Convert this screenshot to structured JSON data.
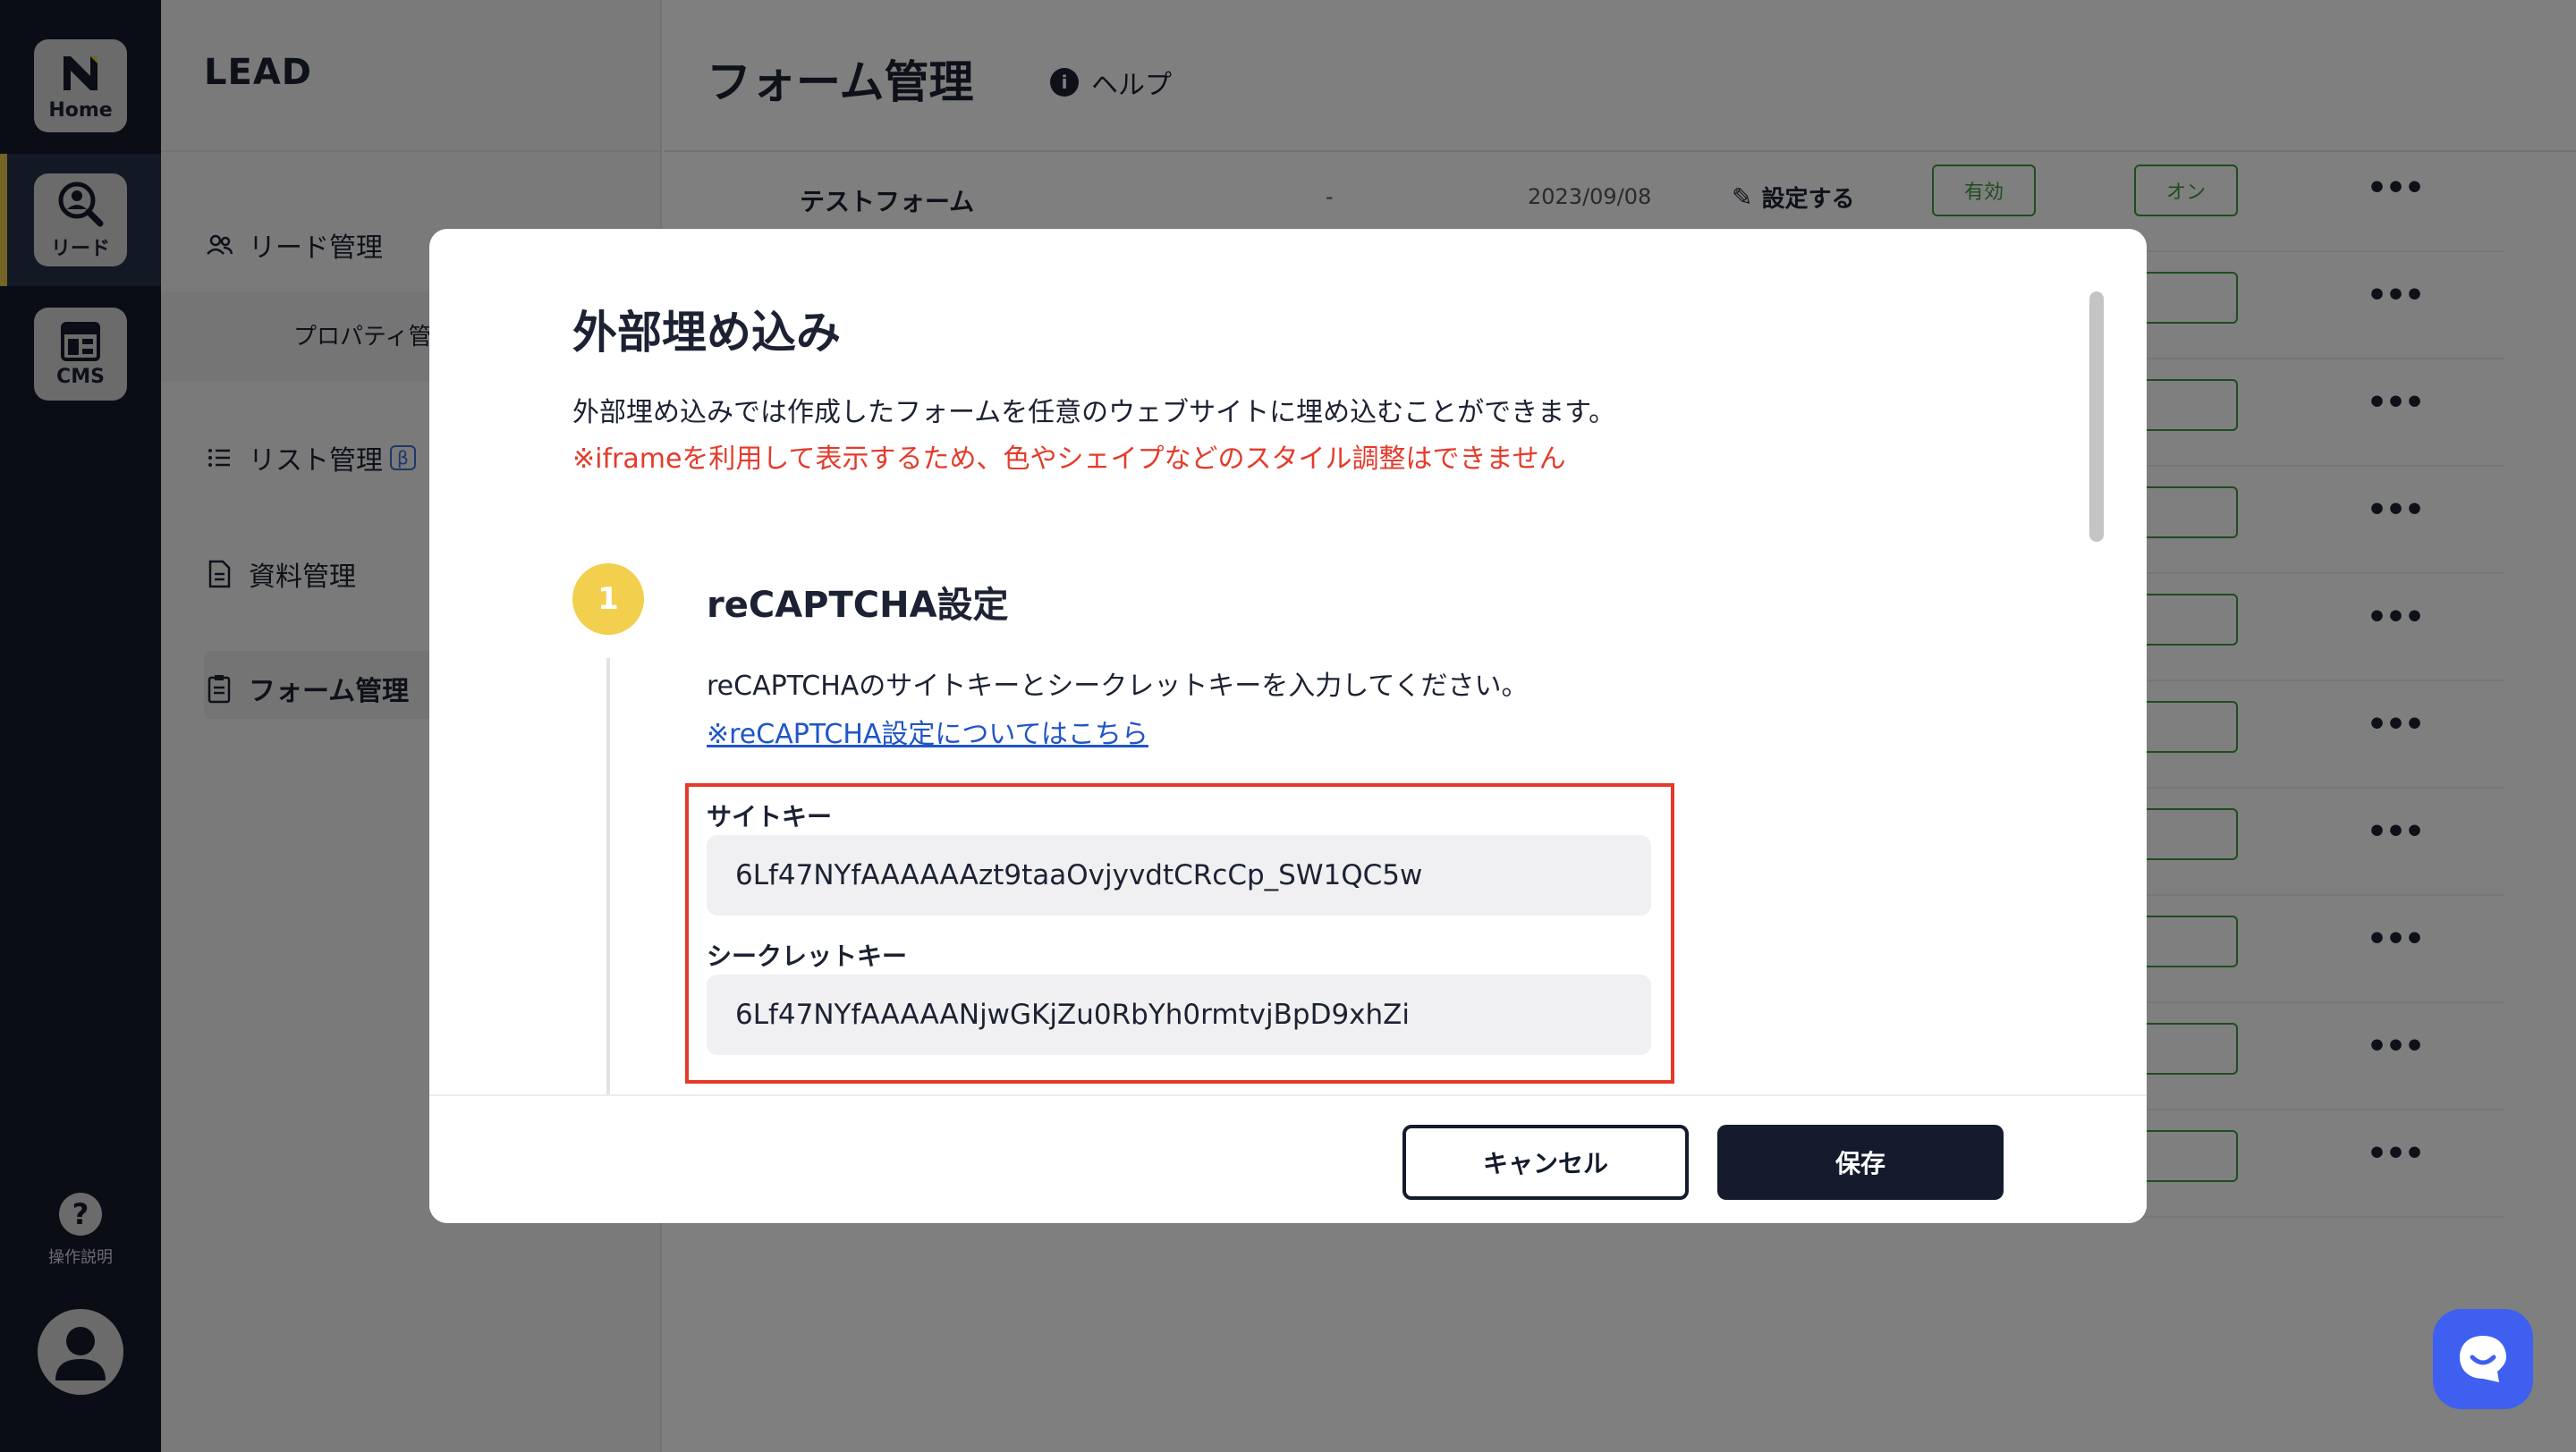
{
  "rail": {
    "home_label": "Home",
    "lead_label": "リード",
    "cms_label": "CMS",
    "help_label": "操作説明"
  },
  "sidebar": {
    "brand": "LEAD",
    "items": [
      {
        "label": "リード管理"
      },
      {
        "label": "プロパティ管"
      },
      {
        "label": "リスト管理",
        "badge": "β"
      },
      {
        "label": "資料管理"
      },
      {
        "label": "フォーム管理"
      }
    ]
  },
  "main": {
    "title": "フォーム管理",
    "help": "ヘルプ",
    "first_row": {
      "name": "テストフォーム",
      "dash": "-",
      "date": "2023/09/08",
      "setting": "設定する",
      "status": "有効",
      "toggle": "オン"
    },
    "more_glyph": "•••"
  },
  "modal": {
    "title": "外部埋め込み",
    "description": "外部埋め込みでは作成したフォームを任意のウェブサイトに埋め込むことができます。",
    "warning": "※iframeを利用して表示するため、色やシェイプなどのスタイル調整はできません",
    "step_number": "1",
    "step_title": "reCAPTCHA設定",
    "step_description": "reCAPTCHAのサイトキーとシークレットキーを入力してください。",
    "step_link": "※reCAPTCHA設定についてはこちら",
    "site_key_label": "サイトキー",
    "site_key_value": "6Lf47NYfAAAAAAzt9taaOvjyvdtCRcCp_SW1QC5w",
    "secret_key_label": "シークレットキー",
    "secret_key_value": "6Lf47NYfAAAAANjwGKjZu0RbYh0rmtvjBpD9xhZi",
    "cancel_label": "キャンセル",
    "save_label": "保存"
  },
  "colors": {
    "navy": "#141b2d",
    "accent_yellow": "#f3cf4e",
    "warning_red": "#e53a2a",
    "link_blue": "#1f55c8",
    "status_green": "#3c9a3c",
    "chat_blue": "#3f5ff0"
  }
}
